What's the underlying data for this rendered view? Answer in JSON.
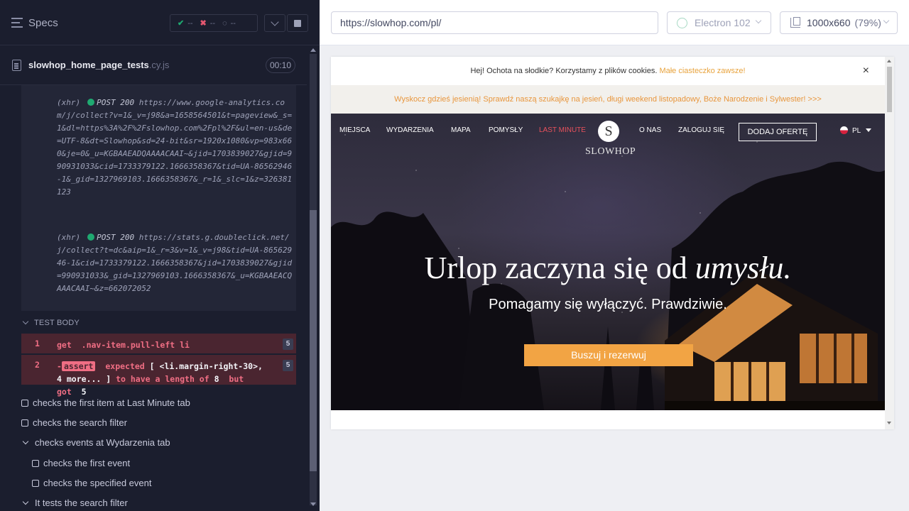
{
  "reporter": {
    "specs_title": "Specs",
    "stats": {
      "passed": "--",
      "failed": "--",
      "pending": "--"
    },
    "file": {
      "name": "slowhop_home_page_tests",
      "ext": ".cy.js",
      "timer": "00:10"
    },
    "log_fragment": "23",
    "log": [
      {
        "kind": "(xhr)",
        "method": "POST 200",
        "url": "https://www.google-analytics.com/j/collect?v=1&_v=j98&a=1658564501&t=pageview&_s=1&dl=https%3A%2F%2Fslowhop.com%2Fpl%2F&ul=en-us&de=UTF-8&dt=Slowhop&sd=24-bit&sr=1920x1080&vp=983x660&je=0&_u=KGBAAEADQAAAACAAI~&jid=1703839027&gjid=990931033&cid=1733379122.1666358367&tid=UA-86562946-1&_gid=1327969103.1666358367&_r=1&_slc=1&z=326381123"
      },
      {
        "kind": "(xhr)",
        "method": "POST 200",
        "url": "https://stats.g.doubleclick.net/j/collect?t=dc&aip=1&_r=3&v=1&_v=j98&tid=UA-86562946-1&cid=1733379122.1666358367&jid=1703839027&gjid=990931033&_gid=1327969103.1666358367&_u=KGBAAEACQAAACAAI~&z=662072052"
      }
    ],
    "test_body_label": "TEST BODY",
    "commands": [
      {
        "num": "1",
        "name": "get",
        "arg": ".nav-item.pull-left li",
        "count": "5"
      },
      {
        "num": "2",
        "prefix": "-",
        "name": "assert",
        "msg_a": "expected",
        "msg_b": "[ <li.margin-right-30>, 4 more... ]",
        "msg_c": "to have a length of",
        "msg_d": "8",
        "msg_e": "but got",
        "msg_f": "5",
        "count": "5"
      }
    ],
    "tests": [
      {
        "label": "checks the first item at Last Minute tab"
      },
      {
        "label": "checks the search filter"
      },
      {
        "label": "checks events at Wydarzenia tab"
      },
      {
        "label": "checks the first event"
      },
      {
        "label": "checks the specified event"
      },
      {
        "label": "It tests the search filter"
      }
    ]
  },
  "runner": {
    "url": "https://slowhop.com/pl/",
    "browser": "Electron 102",
    "viewport": "1000x660",
    "scale": "(79%)"
  },
  "aut": {
    "cookie_text": "Hej! Ochota na słodkie? Korzystamy z",
    "cookie_bold": "plików cookies.",
    "cookie_link": "Małe ciasteczko zawsze!",
    "cookie_close": "×",
    "promo": "Wyskocz gdzieś jesienią! Sprawdź naszą szukajkę na jesień, długi weekend listopadowy, Boże Narodzenie i Sylwester! >>>",
    "nav": [
      "MIEJSCA",
      "WYDARZENIA",
      "MAPA",
      "POMYSŁY",
      "LAST MINUTE",
      "O NAS",
      "ZALOGUJ SIĘ"
    ],
    "logo_text": "SLOWHOP",
    "add_offer": "DODAJ OFERTĘ",
    "lang": "PL",
    "headline_a": "Urlop zaczyna się od",
    "headline_b": "umysłu.",
    "subline": "Pomagamy się wyłączyć. Prawdziwie.",
    "cta": "Buszuj i rezerwuj"
  }
}
